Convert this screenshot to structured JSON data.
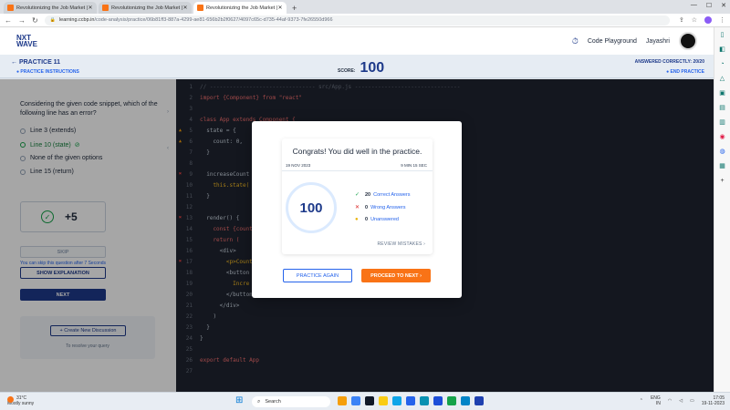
{
  "browser": {
    "tabs": [
      {
        "title": "Revolutionizing the Job Market |"
      },
      {
        "title": "Revolutionizing the Job Market |"
      },
      {
        "title": "Revolutionizing the Job Market |"
      }
    ],
    "url_host": "learning.ccbp.in",
    "url_path": "/code-analysis/practice/06b81ff3-887a-4299-ae81-656b2b2f0627/4097c65c-d735-44af-9373-7fe26550d966"
  },
  "header": {
    "logo_line1": "NXT",
    "logo_line2": "WAVE",
    "playground": "Code Playground",
    "username": "Jayashri"
  },
  "practice": {
    "title": "PRACTICE 11",
    "instructions": "PRACTICE INSTRUCTIONS",
    "score_label": "SCORE:",
    "score": "100",
    "answered": "ANSWERED CORRECTLY: 20/20",
    "end": "END PRACTICE"
  },
  "question": {
    "text": "Considering the given code snippet, which of the following line has an error?",
    "options": [
      {
        "label": "Line 3 (extends)"
      },
      {
        "label": "Line 10 (state)"
      },
      {
        "label": "None of the given options"
      },
      {
        "label": "Line 15 (return)"
      }
    ],
    "points": "+5",
    "skip": "SKIP",
    "skip_note": "You can skip this question after 7 Seconds",
    "explain": "SHOW EXPLANATION",
    "next": "NEXT",
    "new_discussion": "+ Create New Discussion",
    "discussion_note": "To resolve your query"
  },
  "editor": {
    "lines": [
      {
        "n": "1",
        "text": "// -------------------------------- src/App.js --------------------------------"
      },
      {
        "n": "2",
        "text": "import {Component} from \"react\""
      },
      {
        "n": "3",
        "text": ""
      },
      {
        "n": "4",
        "text": "class App extends Component {"
      },
      {
        "n": "5",
        "text": "  state = {"
      },
      {
        "n": "6",
        "text": "    count: 0,"
      },
      {
        "n": "7",
        "text": "  }"
      },
      {
        "n": "8",
        "text": ""
      },
      {
        "n": "9",
        "text": "  increaseCount"
      },
      {
        "n": "10",
        "text": "    this.state("
      },
      {
        "n": "11",
        "text": "  }"
      },
      {
        "n": "12",
        "text": ""
      },
      {
        "n": "13",
        "text": "  render() {"
      },
      {
        "n": "14",
        "text": "    const {count"
      },
      {
        "n": "15",
        "text": "    return ("
      },
      {
        "n": "16",
        "text": "      <div>"
      },
      {
        "n": "17",
        "text": "        <p>Count"
      },
      {
        "n": "18",
        "text": "        <button"
      },
      {
        "n": "19",
        "text": "          Incre"
      },
      {
        "n": "20",
        "text": "        </button>"
      },
      {
        "n": "21",
        "text": "      </div>"
      },
      {
        "n": "22",
        "text": "    )"
      },
      {
        "n": "23",
        "text": "  }"
      },
      {
        "n": "24",
        "text": "}"
      },
      {
        "n": "25",
        "text": ""
      },
      {
        "n": "26",
        "text": "export default App"
      },
      {
        "n": "27",
        "text": ""
      }
    ]
  },
  "modal": {
    "title": "Congrats! You did well in the practice.",
    "date": "19 NOV 2023",
    "time": "9 MIN 15 SEC",
    "score": "100",
    "correct_num": "20",
    "correct_label": "Correct Answers",
    "wrong_num": "0",
    "wrong_label": "Wrong Answers",
    "unanswered_num": "0",
    "unanswered_label": "Unanswered",
    "review": "REVIEW MISTAKES",
    "practice_again": "PRACTICE AGAIN",
    "proceed": "PROCEED TO NEXT"
  },
  "taskbar": {
    "temp": "31°C",
    "weather": "Mostly sunny",
    "search": "Search",
    "lang1": "ENG",
    "lang2": "IN",
    "time": "17:05",
    "date": "19-11-2023"
  }
}
